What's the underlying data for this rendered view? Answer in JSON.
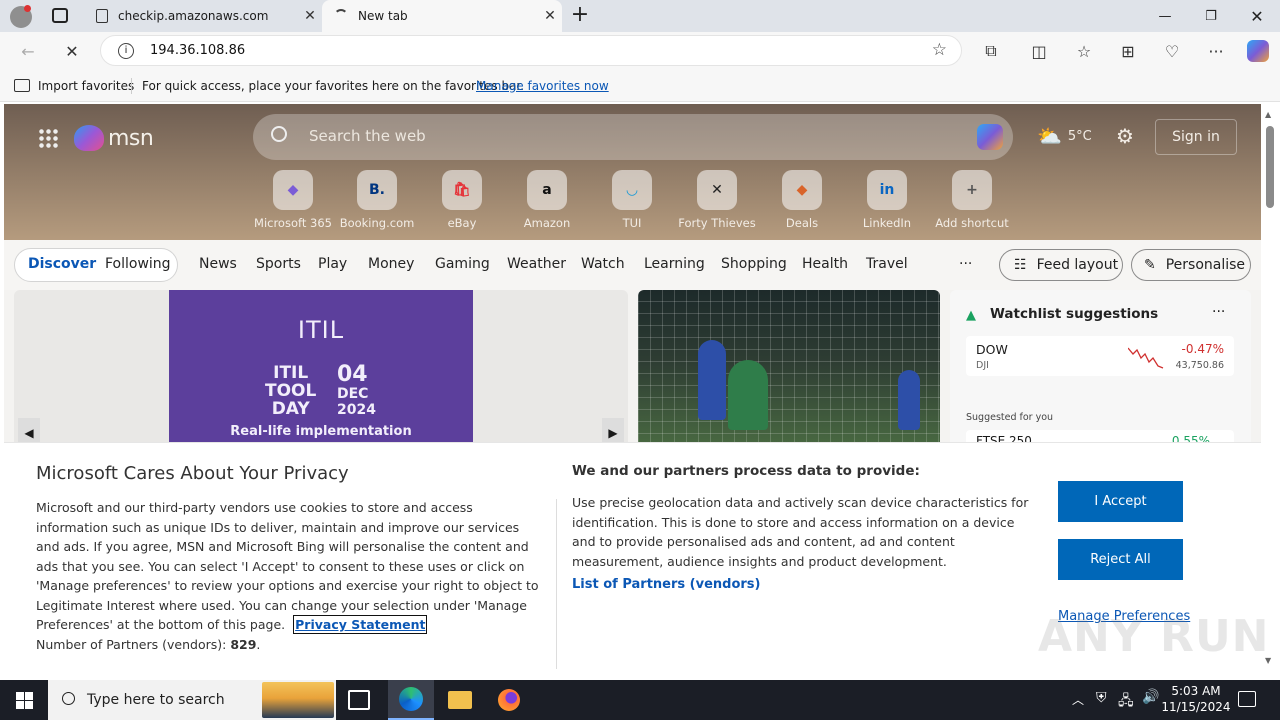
{
  "browser": {
    "tabs": [
      {
        "title": "checkip.amazonaws.com",
        "active": false
      },
      {
        "title": "New tab",
        "active": true
      }
    ],
    "address": "194.36.108.86",
    "favorites_bar": {
      "import_label": "Import favorites",
      "hint": "For quick access, place your favorites here on the favorites bar.",
      "manage_link": "Manage favorites now"
    }
  },
  "msn": {
    "logo": "msn",
    "search_placeholder": "Search the web",
    "weather": "5°C",
    "sign_in": "Sign in",
    "shortcuts": [
      {
        "label": "Microsoft 365",
        "icon": "microsoft-365-icon",
        "glyph": "◆",
        "color": "#7b5cd6"
      },
      {
        "label": "Booking.com",
        "icon": "booking-icon",
        "glyph": "B.",
        "color": "#003580"
      },
      {
        "label": "eBay",
        "icon": "ebay-icon",
        "glyph": "🛍",
        "color": "#e53238"
      },
      {
        "label": "Amazon",
        "icon": "amazon-icon",
        "glyph": "a",
        "color": "#111"
      },
      {
        "label": "TUI",
        "icon": "tui-icon",
        "glyph": "◡",
        "color": "#1a9ad6"
      },
      {
        "label": "Forty Thieves",
        "icon": "forty-thieves-icon",
        "glyph": "✕",
        "color": "#222"
      },
      {
        "label": "Deals",
        "icon": "deals-icon",
        "glyph": "◆",
        "color": "#d9642a"
      },
      {
        "label": "LinkedIn",
        "icon": "linkedin-icon",
        "glyph": "in",
        "color": "#0a66c2"
      },
      {
        "label": "Add shortcut",
        "icon": "plus-icon",
        "glyph": "+",
        "color": "#555"
      }
    ],
    "nav": {
      "discover": "Discover",
      "following": "Following",
      "items": [
        "News",
        "Sports",
        "Play",
        "Money",
        "Gaming",
        "Weather",
        "Watch",
        "Learning",
        "Shopping",
        "Health",
        "Travel"
      ],
      "more": "···",
      "feed_layout": "Feed layout",
      "personalise": "Personalise"
    },
    "promo": {
      "brand": "ITIL",
      "line1": "ITIL",
      "line2": "TOOL",
      "line3": "DAY",
      "day": "04",
      "month": "DEC",
      "year": "2024",
      "tagline": "Real-life implementation"
    },
    "watchlist": {
      "title": "Watchlist suggestions",
      "more": "···",
      "stocks": [
        {
          "name": "DOW",
          "ticker": "DJI",
          "change": "-0.47%",
          "value": "43,750.86"
        }
      ],
      "suggested_label": "Suggested for you",
      "partial": [
        {
          "name": "FTSE 250",
          "change": "0.55%"
        }
      ]
    }
  },
  "privacy": {
    "title": "Microsoft Cares About Your Privacy",
    "body": "Microsoft and our third-party vendors use cookies to store and access information such as unique IDs to deliver, maintain and improve our services and ads. If you agree, MSN and Microsoft Bing will personalise the content and ads that you see. You can select 'I Accept' to consent to these uses or click on 'Manage preferences' to review your options and exercise your right to object to Legitimate Interest where used.  You can change your selection under 'Manage Preferences' at the bottom of this page.",
    "privacy_link": "Privacy Statement",
    "partners_count_label": "Number of Partners (vendors):",
    "partners_count": "829",
    "partners_count_suffix": ".",
    "mid_title": "We and our partners process data to provide:",
    "mid_body": "Use precise geolocation data and actively scan device characteristics for identification. This is done to store and access information on a device and to provide personalised ads and content, ad and content measurement, audience insights and product development.",
    "partners_link": "List of Partners (vendors)",
    "accept": "I Accept",
    "reject": "Reject All",
    "manage": "Manage Preferences"
  },
  "taskbar": {
    "search_placeholder": "Type here to search",
    "time": "5:03 AM",
    "date": "11/15/2024"
  },
  "watermark": "ANY RUN"
}
